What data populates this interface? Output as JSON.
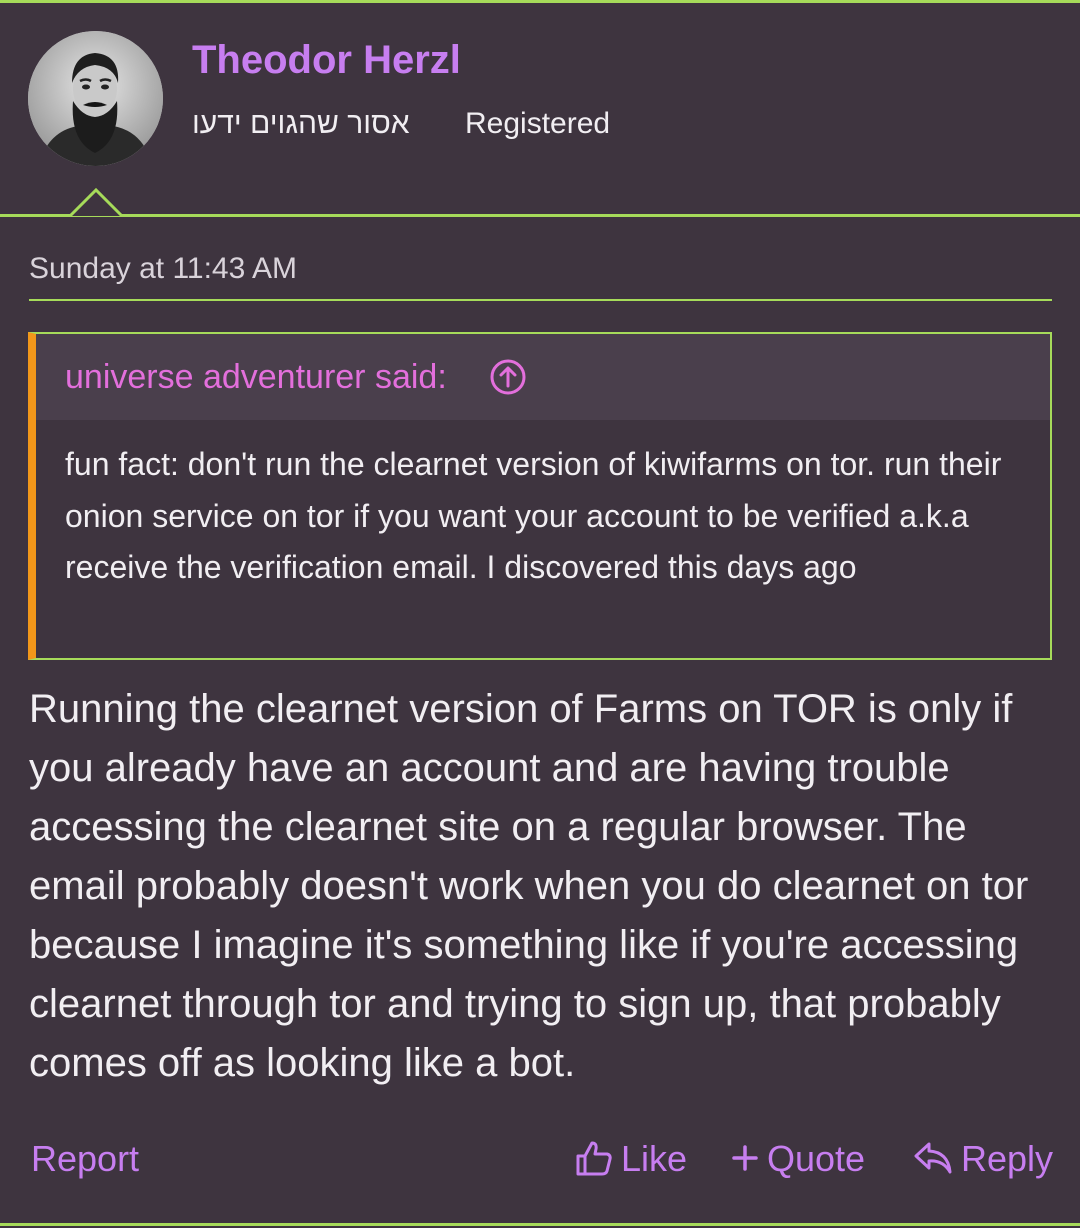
{
  "colors": {
    "background": "#3e343f",
    "accent_green": "#a6db5a",
    "username_purple": "#c77ef0",
    "quote_author_pink": "#e36fdc",
    "quote_bar_orange": "#f2971a",
    "text": "#f1eef2"
  },
  "user": {
    "name": "Theodor Herzl",
    "title": "אסור שהגוים ידעו",
    "banner": "Registered",
    "avatar_icon": "avatar-portrait"
  },
  "post": {
    "timestamp": "Sunday at 11:43 AM",
    "quote": {
      "author_label": "universe adventurer said:",
      "jump_icon": "arrow-up-circle-icon",
      "body": "fun fact: don't run the clearnet version of kiwifarms on tor. run their onion service on tor if you want your account to be verified a.k.a receive the verification email. I discovered this days ago"
    },
    "body": "Running the clearnet version of Farms on TOR is only if you already have an account and are having trouble accessing the clearnet site on a regular browser. The email probably doesn't work when you do clearnet on tor because I imagine it's something like if you're accessing clearnet through tor and trying to sign up, that probably comes off as looking like a bot."
  },
  "actions": {
    "report": "Report",
    "like": "Like",
    "quote": "Quote",
    "reply": "Reply",
    "like_icon": "thumbs-up-icon",
    "quote_icon": "plus-icon",
    "reply_icon": "reply-arrow-icon"
  }
}
